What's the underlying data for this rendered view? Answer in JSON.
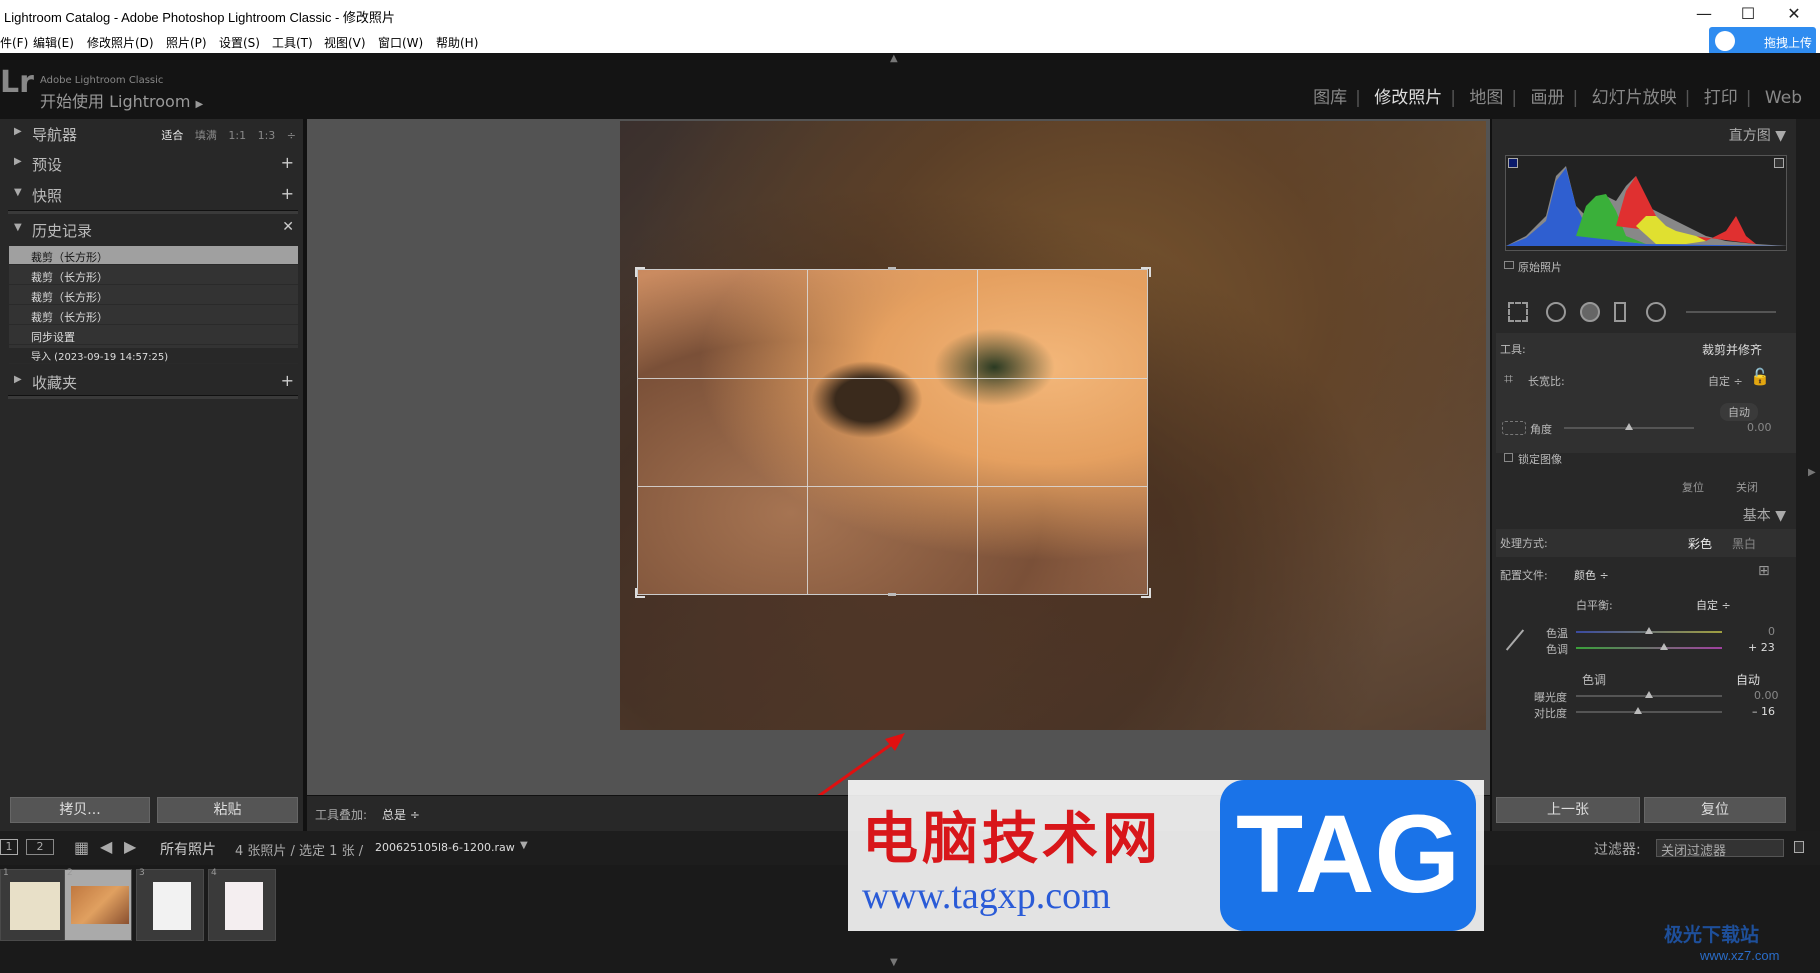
{
  "window": {
    "title": "Lightroom Catalog - Adobe Photoshop Lightroom Classic - 修改照片",
    "minimize": "—",
    "maximize": "☐",
    "close": "✕"
  },
  "menu": [
    "件(F)",
    "编辑(E)",
    "修改照片(D)",
    "照片(P)",
    "设置(S)",
    "工具(T)",
    "视图(V)",
    "窗口(W)",
    "帮助(H)"
  ],
  "upload_label": "拖拽上传",
  "brand": {
    "logo": "Lr",
    "line1": "Adobe Lightroom Classic",
    "line2": "开始使用 Lightroom",
    "arrow": "▶"
  },
  "modules": [
    "图库",
    "修改照片",
    "地图",
    "画册",
    "幻灯片放映",
    "打印",
    "Web"
  ],
  "active_module": "修改照片",
  "left": {
    "navigator": "导航器",
    "nav_options": [
      "适合",
      "填满",
      "1:1",
      "1:3"
    ],
    "presets": "预设",
    "snapshots": "快照",
    "history": "历史记录",
    "history_items": [
      "裁剪（长方形）",
      "裁剪（长方形）",
      "裁剪（长方形）",
      "裁剪（长方形）",
      "同步设置",
      "导入 (2023-09-19 14:57:25)"
    ],
    "collections": "收藏夹",
    "copy_btn": "拷贝...",
    "paste_btn": "粘贴"
  },
  "toolbar": {
    "overlay_label": "工具叠加:",
    "overlay_value": "总是 ÷"
  },
  "right": {
    "histogram": "直方图",
    "original_photo": "原始照片",
    "tool_label": "工具:",
    "tool_value": "裁剪并修齐",
    "aspect_label": "长宽比:",
    "aspect_value": "自定 ÷",
    "auto": "自动",
    "angle_label": "角度",
    "angle_value": "0.00",
    "constrain": "锁定图像",
    "reset": "复位",
    "close": "关闭",
    "basic": "基本",
    "treatment_label": "处理方式:",
    "treatment_color": "彩色",
    "treatment_bw": "黑白",
    "profile_label": "配置文件:",
    "profile_value": "颜色 ÷",
    "wb_label": "白平衡:",
    "wb_value": "自定 ÷",
    "temp_label": "色温",
    "temp_value": "0",
    "tint_label": "色调",
    "tint_value": "+ 23",
    "tone_label": "色调",
    "tone_auto": "自动",
    "exposure_label": "曝光度",
    "exposure_value": "0.00",
    "contrast_label": "对比度",
    "contrast_value": "– 16",
    "prev_btn": "上一张",
    "reset_btn": "复位"
  },
  "filmbar": {
    "view1": "1",
    "view2": "2",
    "source": "所有照片",
    "info": "4 张照片 / 选定 1 张 /",
    "filename": "200625105l8-6-1200.raw",
    "filter_label": "过滤器:",
    "filter_value": "关闭过滤器"
  },
  "thumbs": [
    "1",
    "2",
    "3",
    "4"
  ],
  "watermark": {
    "cn": "电脑技术网",
    "url": "www.tagxp.com",
    "tag": "TAG",
    "site2": "极光下载站",
    "site2_url": "www.xz7.com"
  },
  "colors": {
    "accent": "#d8161a",
    "blue": "#1a73e8"
  }
}
